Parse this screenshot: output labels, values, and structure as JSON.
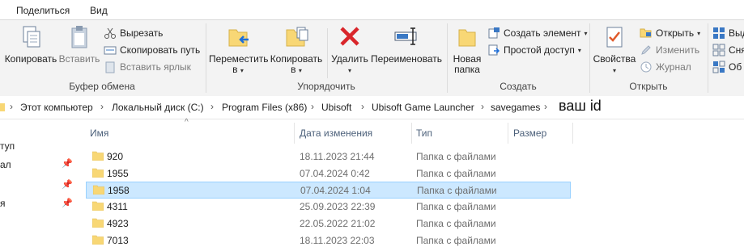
{
  "tabs": [
    "Поделиться",
    "Вид"
  ],
  "clipboard": {
    "copy": "Копировать",
    "paste": "Вставить",
    "cut": "Вырезать",
    "copy_path": "Скопировать путь",
    "paste_shortcut": "Вставить ярлык",
    "group": "Буфер обмена"
  },
  "organize": {
    "move_to": "Переместить",
    "move_to_2": "в",
    "copy_to": "Копировать",
    "copy_to_2": "в",
    "delete": "Удалить",
    "rename": "Переименовать",
    "group": "Упорядочить"
  },
  "new": {
    "new_folder": "Новая",
    "new_folder_2": "папка",
    "new_item": "Создать элемент",
    "easy_access": "Простой доступ",
    "group": "Создать"
  },
  "open": {
    "properties": "Свойства",
    "open": "Открыть",
    "edit": "Изменить",
    "history": "Журнал",
    "group": "Открыть"
  },
  "select": {
    "select_all": "Выд",
    "select_none": "Сня",
    "invert": "Об"
  },
  "breadcrumbs": [
    "Этот компьютер",
    "Локальный диск (C:)",
    "Program Files (x86)",
    "Ubisoft",
    "Ubisoft Game Launcher",
    "savegames"
  ],
  "address_note": "ваш id",
  "nav": [
    "туп",
    "ал",
    "",
    "я"
  ],
  "columns": {
    "name": "Имя",
    "date": "Дата изменения",
    "type": "Тип",
    "size": "Размер"
  },
  "files": [
    {
      "name": "920",
      "date": "18.11.2023 21:44",
      "type": "Папка с файлами"
    },
    {
      "name": "1955",
      "date": "07.04.2024 0:42",
      "type": "Папка с файлами"
    },
    {
      "name": "1958",
      "date": "07.04.2024 1:04",
      "type": "Папка с файлами"
    },
    {
      "name": "4311",
      "date": "25.09.2023 22:39",
      "type": "Папка с файлами"
    },
    {
      "name": "4923",
      "date": "22.05.2022 21:02",
      "type": "Папка с файлами"
    },
    {
      "name": "7013",
      "date": "18.11.2023 22:03",
      "type": "Папка с файлами"
    }
  ],
  "colors": {
    "selection": "#cce8ff",
    "selection_border": "#99d1ff",
    "folder": "#f8d775",
    "delete": "#d9262b"
  }
}
